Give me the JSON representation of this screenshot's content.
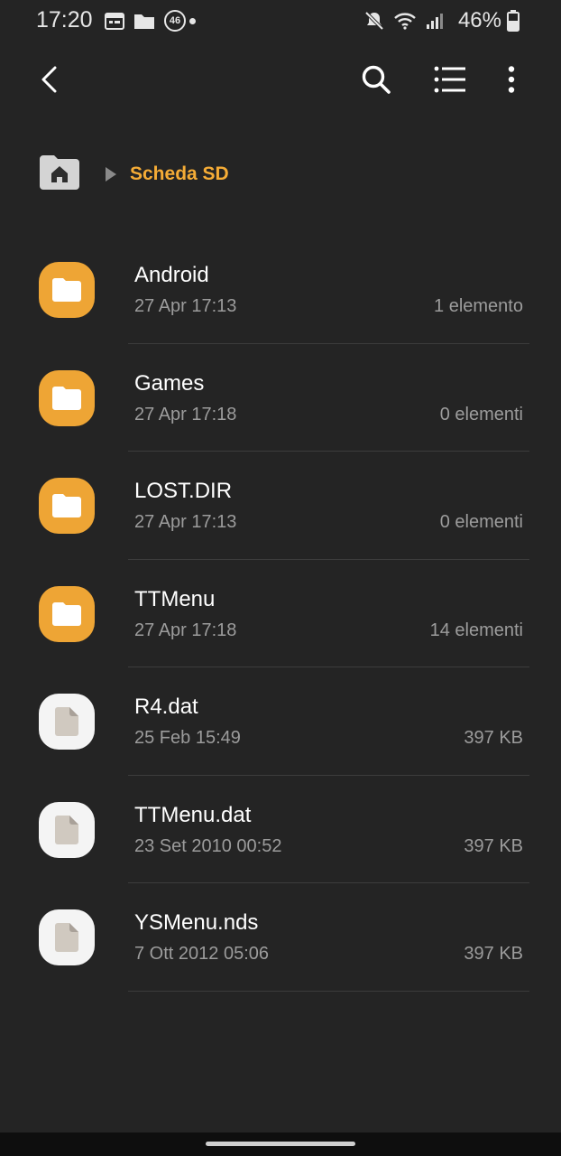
{
  "status_bar": {
    "time": "17:20",
    "left_icons": [
      "calendar-icon",
      "folder-icon",
      "network-46-badge",
      "notification-dot"
    ],
    "badge_text": "46",
    "right_icons": [
      "mute-icon",
      "wifi-icon",
      "signal-icon",
      "battery-icon"
    ],
    "battery_percent": "46%"
  },
  "app_bar": {
    "back_icon": "chevron-left-icon",
    "search_icon": "search-icon",
    "view_icon": "list-view-icon",
    "more_icon": "more-vert-icon"
  },
  "breadcrumb": {
    "home_icon": "home-folder-icon",
    "current": "Scheda SD"
  },
  "colors": {
    "background": "#242424",
    "accent": "#f5ac36",
    "folder": "#eea535",
    "document": "#f4f4f4",
    "secondary_text": "#9c9c9c"
  },
  "files": [
    {
      "name": "Android",
      "date": "27 Apr 17:13",
      "meta": "1 elemento",
      "type": "folder"
    },
    {
      "name": "Games",
      "date": "27 Apr 17:18",
      "meta": "0 elementi",
      "type": "folder"
    },
    {
      "name": "LOST.DIR",
      "date": "27 Apr 17:13",
      "meta": "0 elementi",
      "type": "folder"
    },
    {
      "name": "TTMenu",
      "date": "27 Apr 17:18",
      "meta": "14 elementi",
      "type": "folder"
    },
    {
      "name": "R4.dat",
      "date": "25 Feb 15:49",
      "meta": "397 KB",
      "type": "file"
    },
    {
      "name": "TTMenu.dat",
      "date": "23 Set 2010 00:52",
      "meta": "397 KB",
      "type": "file"
    },
    {
      "name": "YSMenu.nds",
      "date": "7 Ott 2012 05:06",
      "meta": "397 KB",
      "type": "file"
    }
  ]
}
